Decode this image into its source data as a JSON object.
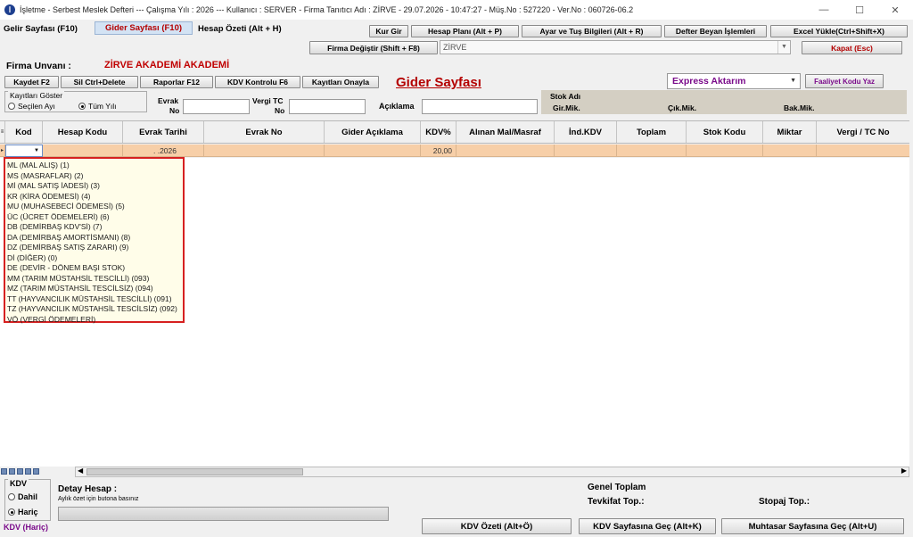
{
  "window": {
    "title": "İşletme - Serbest Meslek Defteri  ---  Çalışma Yılı : 2026  ---  Kullanıcı : SERVER - Firma Tanıtıcı Adı : ZİRVE - 29.07.2026 - 10:47:27 - Müş.No : 527220 - Ver.No : 060726-06.2",
    "icon_letter": "İ"
  },
  "tabs": {
    "gelir": "Gelir Sayfası (F10)",
    "gider": "Gider Sayfası (F10)",
    "hesap_ozeti": "Hesap Özeti (Alt + H)"
  },
  "top_buttons": {
    "kur_gir": "Kur Gir",
    "hesap_plani": "Hesap Planı (Alt + P)",
    "ayar_tus": "Ayar ve Tuş Bilgileri (Alt + R)",
    "defter_beyan": "Defter Beyan İşlemleri",
    "excel_yukle": "Excel Yükle(Ctrl+Shift+X)",
    "firma_degistir": "Firma Değiştir (Shift + F8)",
    "kapat": "Kapat (Esc)"
  },
  "firma": {
    "combo_value": "ZİRVE",
    "label": "Firma Unvanı :",
    "name": "ZİRVE AKADEMİ AKADEMİ"
  },
  "toolbar": {
    "kaydet": "Kaydet F2",
    "sil": "Sil Ctrl+Delete",
    "raporlar": "Raporlar F12",
    "kdv_kontrolu": "KDV Kontrolu F6",
    "kayitlari_onayla": "Kayıtları Onayla"
  },
  "page_title": "Gider Sayfası",
  "express": {
    "selected": "Express Aktarım",
    "faaliyet_button": "Faaliyet Kodu Yaz"
  },
  "filters": {
    "kayitlari_goster": "Kayıtları Göster",
    "secilen_ay": "Seçilen Ayı",
    "tum_yili": "Tüm Yılı",
    "evrak_no_1": "Evrak",
    "evrak_no_2": "No",
    "vergi_tc_1": "Vergi TC",
    "vergi_tc_2": "No",
    "aciklama": "Açıklama"
  },
  "stok": {
    "title": "Stok Adı",
    "gir_mik": "Gir.Mik.",
    "cik_mik": "Çık.Mik.",
    "bak_mik": "Bak.Mik."
  },
  "columns": [
    "Kod",
    "Hesap Kodu",
    "Evrak Tarihi",
    "Evrak No",
    "Gider Açıklama",
    "KDV%",
    "Alınan Mal/Masraf",
    "İnd.KDV",
    "Toplam",
    "Stok Kodu",
    "Miktar",
    "Vergi / TC No"
  ],
  "row": {
    "evrak_tarihi": ".  .2026",
    "kdv": "20,00"
  },
  "dropdown_items": [
    "ML (MAL ALIŞ) (1)",
    "MS (MASRAFLAR) (2)",
    "Mİ (MAL SATIŞ İADESİ) (3)",
    "KR (KİRA ÖDEMESİ) (4)",
    "MU (MUHASEBECİ ÖDEMESİ) (5)",
    "ÜC (ÜCRET ÖDEMELERİ) (6)",
    "DB (DEMİRBAŞ KDV'Sİ) (7)",
    "DA (DEMİRBAŞ AMORTİSMANI) (8)",
    "DZ (DEMİRBAŞ SATIŞ ZARARI) (9)",
    "Dİ (DİĞER) (0)",
    "DE (DEVİR - DÖNEM BAŞI STOK)",
    "MM (TARIM MÜSTAHSİL TESCİLLİ) (093)",
    "MZ (TARIM MÜSTAHSİL TESCİLSİZ) (094)",
    "TT (HAYVANCILIK MÜSTAHSİL TESCİLLİ) (091)",
    "TZ (HAYVANCILIK MÜSTAHSİL TESCİLSİZ) (092)",
    "VÖ (VERGİ ÖDEMELERİ)"
  ],
  "bottom": {
    "kdv_title": "KDV",
    "dahil": "Dahil",
    "haric": "Hariç",
    "kdv_hint": "KDV (Hariç)",
    "detay_hesap": "Detay Hesap :",
    "detay_sub": "Aylık özet için butona basınız",
    "genel_toplam": "Genel Toplam",
    "tevkifat": "Tevkifat  Top.:",
    "stopaj": "Stopaj  Top.:",
    "kdv_ozeti": "KDV Özeti (Alt+Ö)",
    "kdv_sayfasina": "KDV Sayfasına Geç (Alt+K)",
    "muhtasar": "Muhtasar Sayfasına Geç (Alt+U)"
  },
  "colors": {
    "accent_red": "#b40000",
    "row_highlight": "#f7cfa8",
    "dropdown_bg": "#fffde9",
    "dropdown_border": "#d62020",
    "express_purple": "#7a0a8a"
  }
}
